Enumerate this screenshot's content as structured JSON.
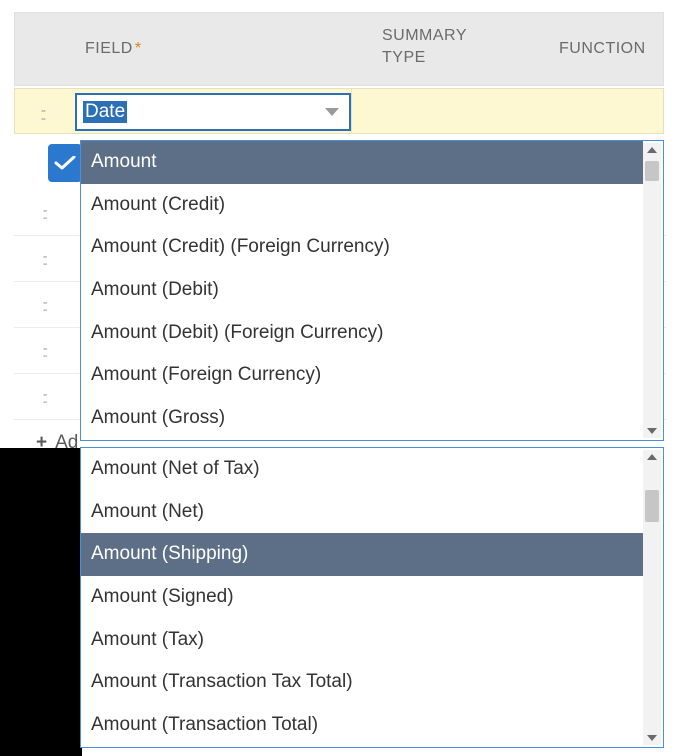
{
  "header": {
    "field_label": "FIELD",
    "required_marker": "*",
    "summary_label": "SUMMARY\nTYPE",
    "function_label": "FUNCTION"
  },
  "field_select": {
    "value": "Date"
  },
  "add_row_label_visible": "Ad",
  "dropdown1": {
    "items": [
      {
        "label": "Amount",
        "highlight": true
      },
      {
        "label": "Amount (Credit)"
      },
      {
        "label": "Amount (Credit) (Foreign Currency)"
      },
      {
        "label": "Amount (Debit)"
      },
      {
        "label": "Amount (Debit) (Foreign Currency)"
      },
      {
        "label": "Amount (Foreign Currency)"
      },
      {
        "label": "Amount (Gross)"
      }
    ]
  },
  "dropdown2": {
    "items": [
      {
        "label": "Amount (Net of Tax)"
      },
      {
        "label": "Amount (Net)"
      },
      {
        "label": "Amount (Shipping)",
        "highlight": true
      },
      {
        "label": "Amount (Signed)"
      },
      {
        "label": "Amount (Tax)"
      },
      {
        "label": "Amount (Transaction Tax Total)"
      },
      {
        "label": "Amount (Transaction Total)"
      }
    ]
  },
  "glyphs": {
    "drag": "::",
    "plus": "+"
  }
}
